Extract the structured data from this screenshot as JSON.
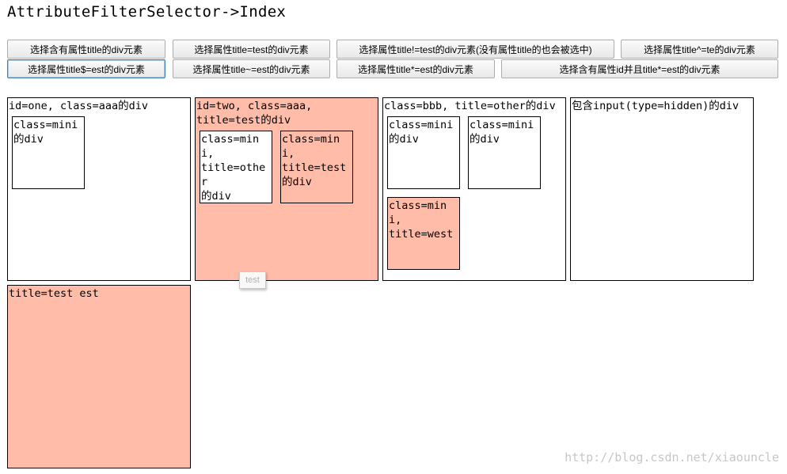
{
  "title": "AttributeFilterSelector->Index",
  "buttons": {
    "row1": [
      "选择含有属性title的div元素",
      "选择属性title=test的div元素",
      "选择属性title!=test的div元素(没有属性title的也会被选中)",
      "选择属性title^=te的div元素"
    ],
    "row2": [
      "选择属性title$=est的div元素",
      "选择属性title~=est的div元素",
      "选择属性title*=est的div元素",
      "选择含有属性id并且title*=est的div元素"
    ]
  },
  "boxes": {
    "one": {
      "label": "id=one, class=aaa的div",
      "minis": [
        "class=mini\n的div"
      ]
    },
    "two": {
      "label": "id=two, class=aaa,\ntitle=test的div",
      "minis": [
        "class=mini,\ntitle=other\n的div",
        "class=mini,\ntitle=test\n的div"
      ]
    },
    "three": {
      "label": "class=bbb, title=other的div",
      "minis": [
        "class=mini\n的div",
        "class=mini\n的div",
        "class=mini,\ntitle=west"
      ]
    },
    "four": {
      "label": "包含input(type=hidden)的div"
    },
    "five": {
      "label": "title=test est"
    }
  },
  "tooltip": "test",
  "watermark": "http://blog.csdn.net/xiaouncle",
  "colors": {
    "highlight": "#ffbca8",
    "border": "#000000",
    "background": "#ffffff"
  }
}
